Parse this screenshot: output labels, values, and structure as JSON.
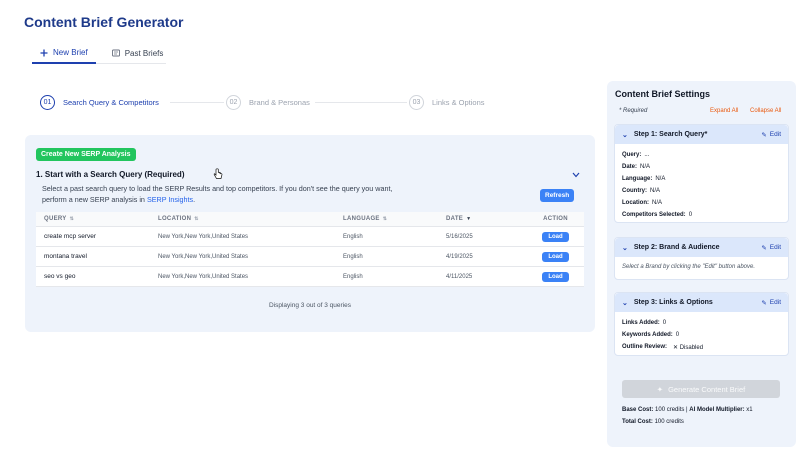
{
  "app": {
    "title": "Content Brief Generator"
  },
  "tabs": [
    {
      "label": "New Brief",
      "icon": "plus-icon",
      "active": true
    },
    {
      "label": "Past Briefs",
      "icon": "document-icon",
      "active": false
    }
  ],
  "stepper": [
    {
      "num": "01",
      "label": "Search Query & Competitors",
      "active": true
    },
    {
      "num": "02",
      "label": "Brand & Personas",
      "active": false
    },
    {
      "num": "03",
      "label": "Links & Options",
      "active": false
    }
  ],
  "main": {
    "create_button": "Create New SERP Analysis",
    "section_title": "1. Start with a Search Query (Required)",
    "desc_text": "Select a past search query to load the SERP Results and top competitors. If you don't see the query you want, perform a new SERP analysis in ",
    "desc_link": "SERP Insights",
    "desc_end": ".",
    "refresh_button": "Refresh",
    "table": {
      "headers": [
        "QUERY",
        "LOCATION",
        "LANGUAGE",
        "DATE",
        "ACTION"
      ],
      "rows": [
        {
          "query": "create mcp server",
          "location": "New York,New York,United States",
          "language": "English",
          "date": "5/16/2025",
          "action": "Load"
        },
        {
          "query": "montana travel",
          "location": "New York,New York,United States",
          "language": "English",
          "date": "4/19/2025",
          "action": "Load"
        },
        {
          "query": "seo vs geo",
          "location": "New York,New York,United States",
          "language": "English",
          "date": "4/11/2025",
          "action": "Load"
        }
      ],
      "footer": "Displaying 3 out of 3 queries"
    }
  },
  "settings": {
    "title": "Content Brief Settings",
    "required_note": "* Required",
    "expand_all": "Expand All",
    "collapse_all": "Collapse All",
    "edit_label": "Edit",
    "step1": {
      "title": "Step 1: Search Query*",
      "fields": [
        {
          "key": "Query:",
          "value": "..."
        },
        {
          "key": "Date:",
          "value": "N/A"
        },
        {
          "key": "Language:",
          "value": "N/A"
        },
        {
          "key": "Country:",
          "value": "N/A"
        },
        {
          "key": "Location:",
          "value": "N/A"
        },
        {
          "key": "Competitors Selected:",
          "value": "0"
        }
      ]
    },
    "step2": {
      "title": "Step 2: Brand & Audience",
      "note": "Select a Brand by clicking the \"Edit\" button above."
    },
    "step3": {
      "title": "Step 3: Links & Options",
      "fields": [
        {
          "key": "Links Added:",
          "value": "0"
        },
        {
          "key": "Keywords Added:",
          "value": "0"
        },
        {
          "key": "Outline Review:",
          "value": "✕  Disabled"
        }
      ]
    },
    "generate_button": "Generate Content Brief",
    "base_cost_label": "Base Cost:",
    "base_cost_value": "100 credits",
    "multiplier_label": "AI Model Multiplier:",
    "multiplier_value": "x1",
    "total_cost_label": "Total Cost:",
    "total_cost_value": "100 credits"
  },
  "colors": {
    "primary": "#1e40af",
    "accent_green": "#22c55e",
    "button_blue": "#3b82f6",
    "orange_link": "#ea580c",
    "panel_bg": "#eef3fb"
  }
}
